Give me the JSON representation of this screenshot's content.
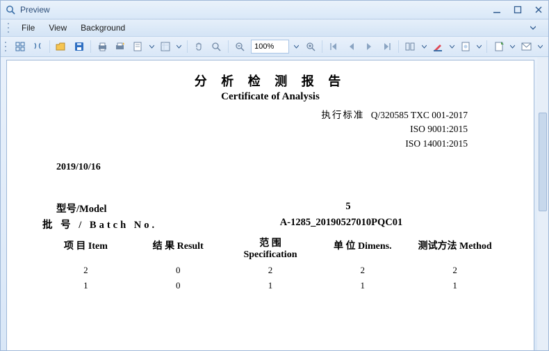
{
  "window": {
    "title": "Preview"
  },
  "menubar": {
    "file": "File",
    "view": "View",
    "background": "Background"
  },
  "toolbar": {
    "zoom": "100%"
  },
  "doc": {
    "title_cn": "分 析 检 测 报 告",
    "title_en": "Certificate of Analysis",
    "std_label": "执行标准",
    "std1": "Q/320585 TXC 001-2017",
    "std2": "ISO  9001:2015",
    "std3": "ISO  14001:2015",
    "date": "2019/10/16",
    "model_label": "型号/Model",
    "model_value": "5",
    "batch_label": "批   号 / Batch No.",
    "batch_value": "A-1285_20190527010PQC01",
    "headers": {
      "item": "项 目 Item",
      "result": "结 果 Result",
      "spec_cn": "范 围",
      "spec_en": "Specification",
      "dimens": "单 位 Dimens.",
      "method": "测试方法 Method"
    },
    "rows": [
      {
        "item": "2",
        "result": "0",
        "spec": "2",
        "dimens": "2",
        "method": "2"
      },
      {
        "item": "1",
        "result": "0",
        "spec": "1",
        "dimens": "1",
        "method": "1"
      }
    ]
  }
}
